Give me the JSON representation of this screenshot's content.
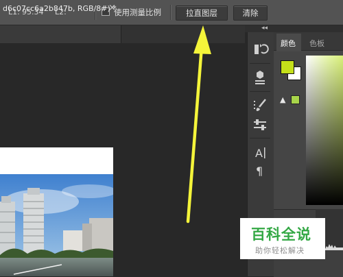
{
  "options_bar": {
    "l1_label": "L1:",
    "l1_value": "95.34",
    "l2_label": "L2:",
    "measure_scale_label": "使用测量比例",
    "straighten_button": "拉直图层",
    "clear_button": "清除"
  },
  "document": {
    "tab_label": "d6c07cc6a2b847b, RGB/8#)",
    "tab_modified_marker": "*",
    "tab_close": "×"
  },
  "panels": {
    "tab_color": "颜色",
    "tab_swatches": "色板",
    "foreground_color": "#c5e01a",
    "background_color": "#ffffff",
    "gamut_color": "#a8d44a",
    "warning_symbol": "▲"
  },
  "watermark": {
    "title": "百科全说",
    "subtitle": "助你轻松解决"
  },
  "annotation": {
    "arrow_color": "#f4f43a"
  },
  "icons": {
    "history": "history-icon",
    "properties": "properties-icon",
    "brush": "brush-icon",
    "brush_settings": "brush-settings-icon",
    "character": "character-icon",
    "paragraph": "paragraph-icon"
  }
}
